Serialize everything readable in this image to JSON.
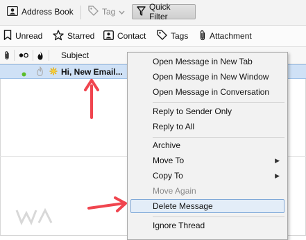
{
  "toolbar": {
    "address_book": "Address Book",
    "tag": "Tag",
    "quick_filter": "Quick Filter"
  },
  "filterbar": {
    "unread": "Unread",
    "starred": "Starred",
    "contact": "Contact",
    "tags": "Tags",
    "attachment": "Attachment"
  },
  "columns": {
    "subject": "Subject"
  },
  "message": {
    "subject": "Hi, New Email..."
  },
  "context_menu": {
    "open_new_tab": "Open Message in New Tab",
    "open_new_window": "Open Message in New Window",
    "open_conversation": "Open Message in Conversation",
    "reply_sender": "Reply to Sender Only",
    "reply_all": "Reply to All",
    "archive": "Archive",
    "move_to": "Move To",
    "copy_to": "Copy To",
    "move_again": "Move Again",
    "delete": "Delete Message",
    "ignore_thread": "Ignore Thread"
  },
  "colors": {
    "annotation_arrow": "#f0454f",
    "selection": "#cfe1f6",
    "menu_highlight_border": "#7fa8d8"
  }
}
